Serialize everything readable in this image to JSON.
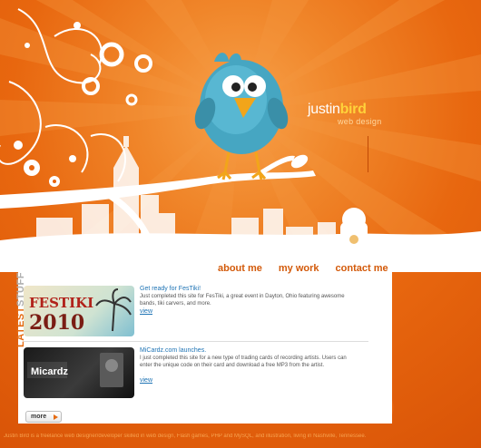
{
  "logo": {
    "word_plain": "justin",
    "word_bold": "bird",
    "tagline": "web design"
  },
  "nav": {
    "about": "about me",
    "work": "my work",
    "contact": "contact me"
  },
  "side_label": {
    "word1": "LATEST",
    "word2": "STUFF"
  },
  "items": [
    {
      "thumb_text": "FESTIKI 2010",
      "title": "Get ready for FesTiki!",
      "description": "Just completed this site for FesTiki, a great event in Dayton, Ohio featuring awesome bands, tiki carvers, and more.",
      "link": "view"
    },
    {
      "thumb_text": "Micardz",
      "title": "MiCardz.com launches.",
      "description": "I just completed this site for a new type of trading cards of recording artists. Users can enter the unique code on their card and download a free MP3 from the artist.",
      "link": "view"
    }
  ],
  "more_label": "more",
  "footer": "Justin Bird is a freelance web designer/developer skilled in web design, Flash games, PHP and MySQL, and illustration, living in Nashville, Tennessee.",
  "colors": {
    "brand_orange": "#e8650f",
    "link_blue": "#1e73b4",
    "gold": "#ffd23a"
  }
}
